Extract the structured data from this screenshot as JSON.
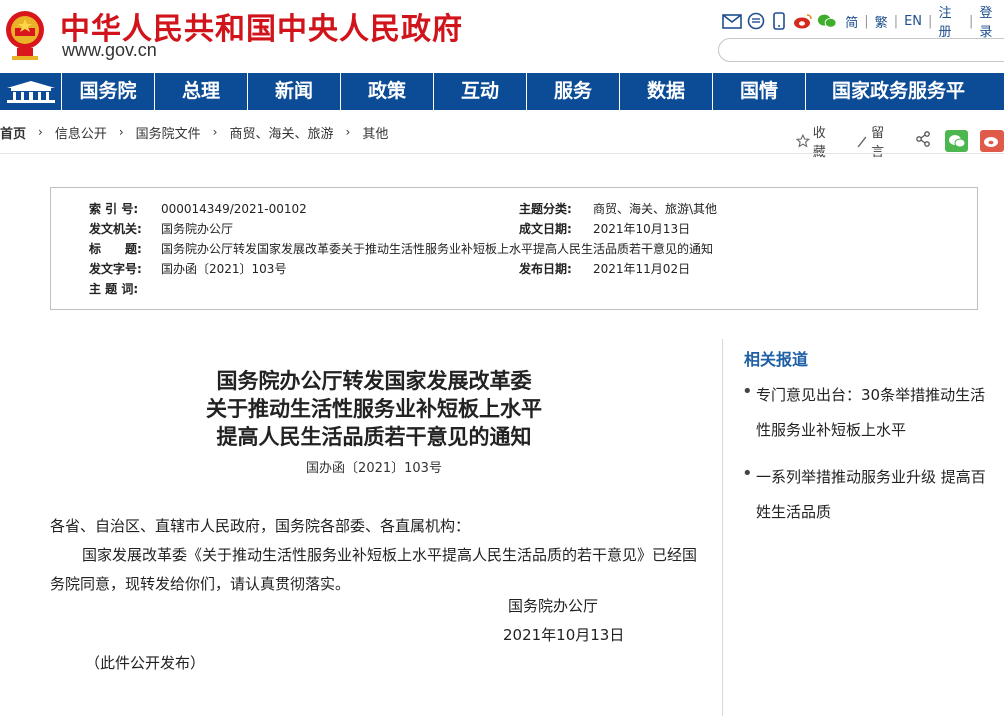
{
  "header": {
    "site_title": "中华人民共和国中央人民政府",
    "site_url": "www.gov.cn",
    "top_links": [
      "简",
      "繁",
      "EN",
      "注册",
      "登录"
    ],
    "colors": {
      "title_red": "#d1141b",
      "nav_blue": "#0c4c96"
    }
  },
  "nav": {
    "items": [
      "国务院",
      "总理",
      "新闻",
      "政策",
      "互动",
      "服务",
      "数据",
      "国情",
      "国家政务服务平"
    ]
  },
  "breadcrumb": {
    "items": [
      "首页",
      "信息公开",
      "国务院文件",
      "商贸、海关、旅游",
      "其他"
    ],
    "actions": {
      "favorite": "收藏",
      "comment": "留言"
    }
  },
  "info": {
    "index_label": "索 引 号:",
    "index_value": "000014349/2021-00102",
    "issuer_label": "发文机关:",
    "issuer_value": "国务院办公厅",
    "title_label": "标　　题:",
    "title_value": "国务院办公厅转发国家发展改革委关于推动生活性服务业补短板上水平提高人民生活品质若干意见的通知",
    "docno_label": "发文字号:",
    "docno_value": "国办函〔2021〕103号",
    "keywords_label": "主 题 词:",
    "keywords_value": "",
    "category_label": "主题分类:",
    "category_value": "商贸、海关、旅游\\其他",
    "written_label": "成文日期:",
    "written_value": "2021年10月13日",
    "published_label": "发布日期:",
    "published_value": "2021年11月02日"
  },
  "article": {
    "title_line1": "国务院办公厅转发国家发展改革委",
    "title_line2": "关于推动生活性服务业补短板上水平",
    "title_line3": "提高人民生活品质若干意见的通知",
    "doc_no": "国办函〔2021〕103号",
    "salutation": "各省、自治区、直辖市人民政府，国务院各部委、各直属机构：",
    "paragraph": "国家发展改革委《关于推动生活性服务业补短板上水平提高人民生活品质的若干意见》已经国务院同意，现转发给你们，请认真贯彻落实。",
    "signer": "国务院办公厅",
    "date": "2021年10月13日",
    "note": "（此件公开发布）"
  },
  "sidebar": {
    "title": "相关报道",
    "items": [
      "专门意见出台：30条举措推动生活性服务业补短板上水平",
      "一系列举措推动服务业升级 提高百姓生活品质"
    ]
  }
}
